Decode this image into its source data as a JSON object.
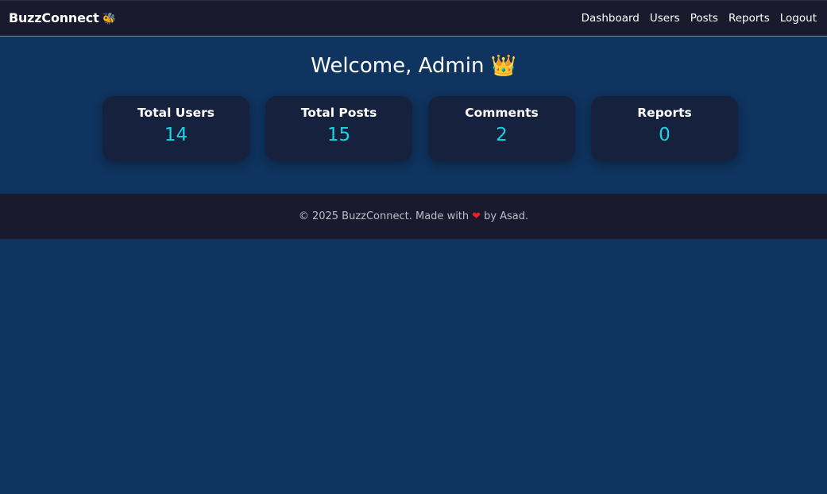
{
  "nav": {
    "brand": "BuzzConnect",
    "brand_icon": "🐝",
    "links": [
      "Dashboard",
      "Users",
      "Posts",
      "Reports",
      "Logout"
    ]
  },
  "welcome": {
    "text": "Welcome, Admin",
    "icon": "👑"
  },
  "stats": [
    {
      "label": "Total Users",
      "value": "14"
    },
    {
      "label": "Total Posts",
      "value": "15"
    },
    {
      "label": "Comments",
      "value": "2"
    },
    {
      "label": "Reports",
      "value": "0"
    }
  ],
  "footer": {
    "prefix": "© 2025 BuzzConnect. Made with",
    "heart": "❤",
    "suffix": "by Asad."
  },
  "colors": {
    "background": "#0f3460",
    "navbar": "#1a1a2e",
    "card": "#16213e",
    "accent": "#19d3e6",
    "heart": "#e8202a"
  }
}
